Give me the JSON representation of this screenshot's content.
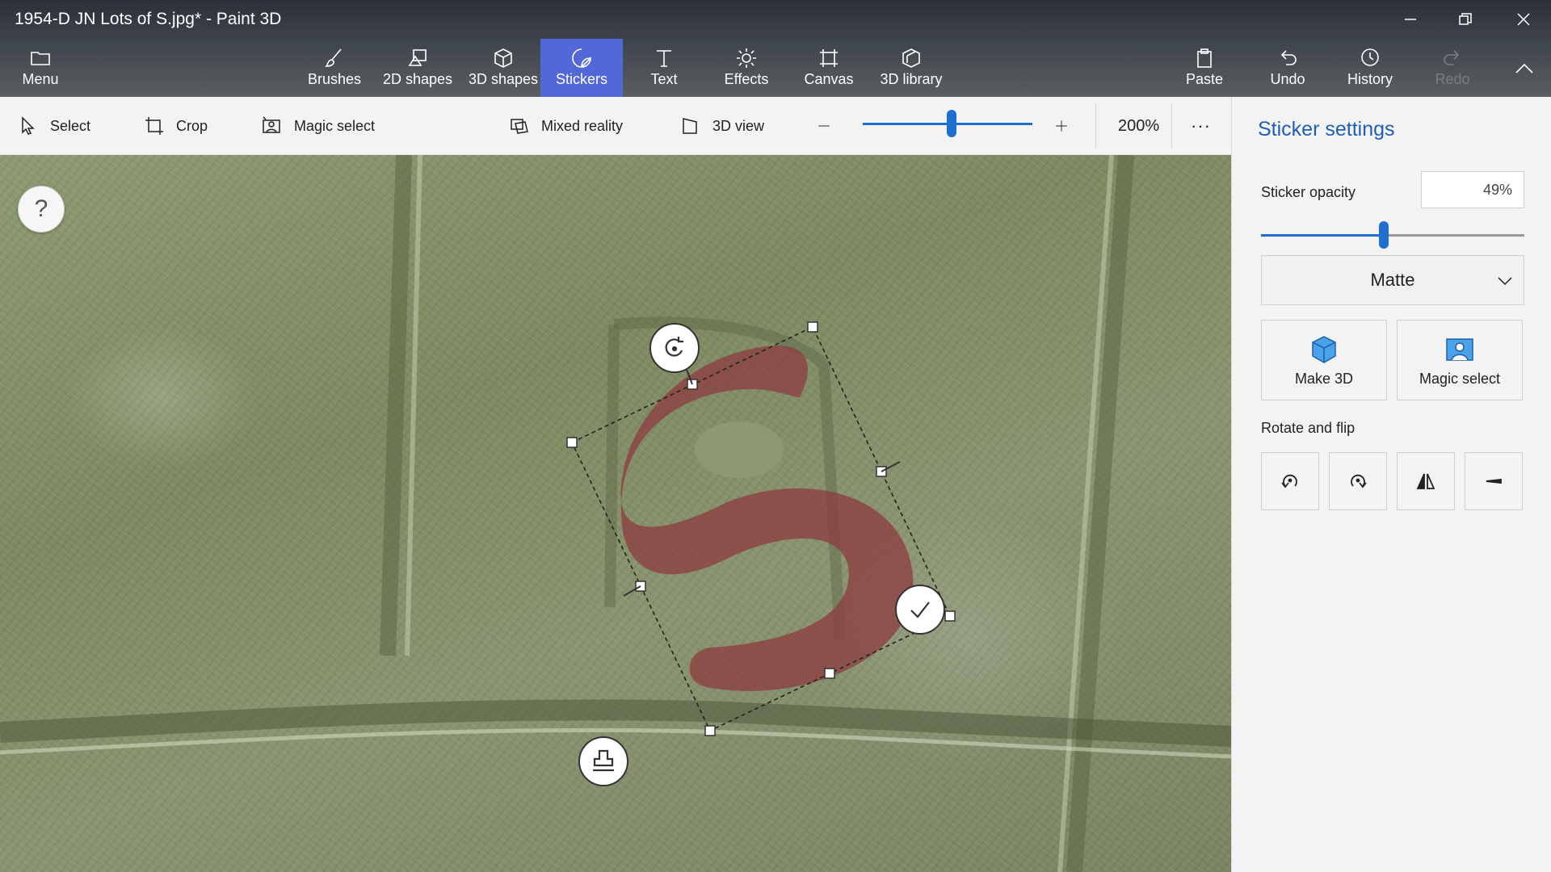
{
  "window": {
    "title": "1954-D JN Lots of S.jpg* - Paint 3D"
  },
  "menu": {
    "label": "Menu"
  },
  "tabs": [
    {
      "label": "Brushes",
      "icon": "brush-icon"
    },
    {
      "label": "2D shapes",
      "icon": "2d-shapes-icon"
    },
    {
      "label": "3D shapes",
      "icon": "3d-shapes-icon"
    },
    {
      "label": "Stickers",
      "icon": "stickers-icon",
      "active": true
    },
    {
      "label": "Text",
      "icon": "text-icon"
    },
    {
      "label": "Effects",
      "icon": "effects-icon"
    },
    {
      "label": "Canvas",
      "icon": "canvas-icon"
    },
    {
      "label": "3D library",
      "icon": "3d-library-icon"
    }
  ],
  "actions": {
    "paste": "Paste",
    "undo": "Undo",
    "history": "History",
    "redo": "Redo"
  },
  "toolbar": {
    "select": "Select",
    "crop": "Crop",
    "magic_select": "Magic select",
    "mixed_reality": "Mixed reality",
    "view_3d": "3D view",
    "zoom": "200%",
    "more": "···"
  },
  "canvas": {
    "help": "?"
  },
  "panel": {
    "title": "Sticker settings",
    "opacity_label": "Sticker opacity",
    "opacity_value": "49%",
    "opacity_fraction": 0.49,
    "finish": "Matte",
    "make_3d": "Make 3D",
    "magic_select": "Magic select",
    "rotate_flip_label": "Rotate and flip"
  },
  "colors": {
    "accent": "#5267d8",
    "link_blue": "#1f5fb5",
    "slider_blue": "#1f6fd1",
    "sticker": "#8e3b40"
  }
}
